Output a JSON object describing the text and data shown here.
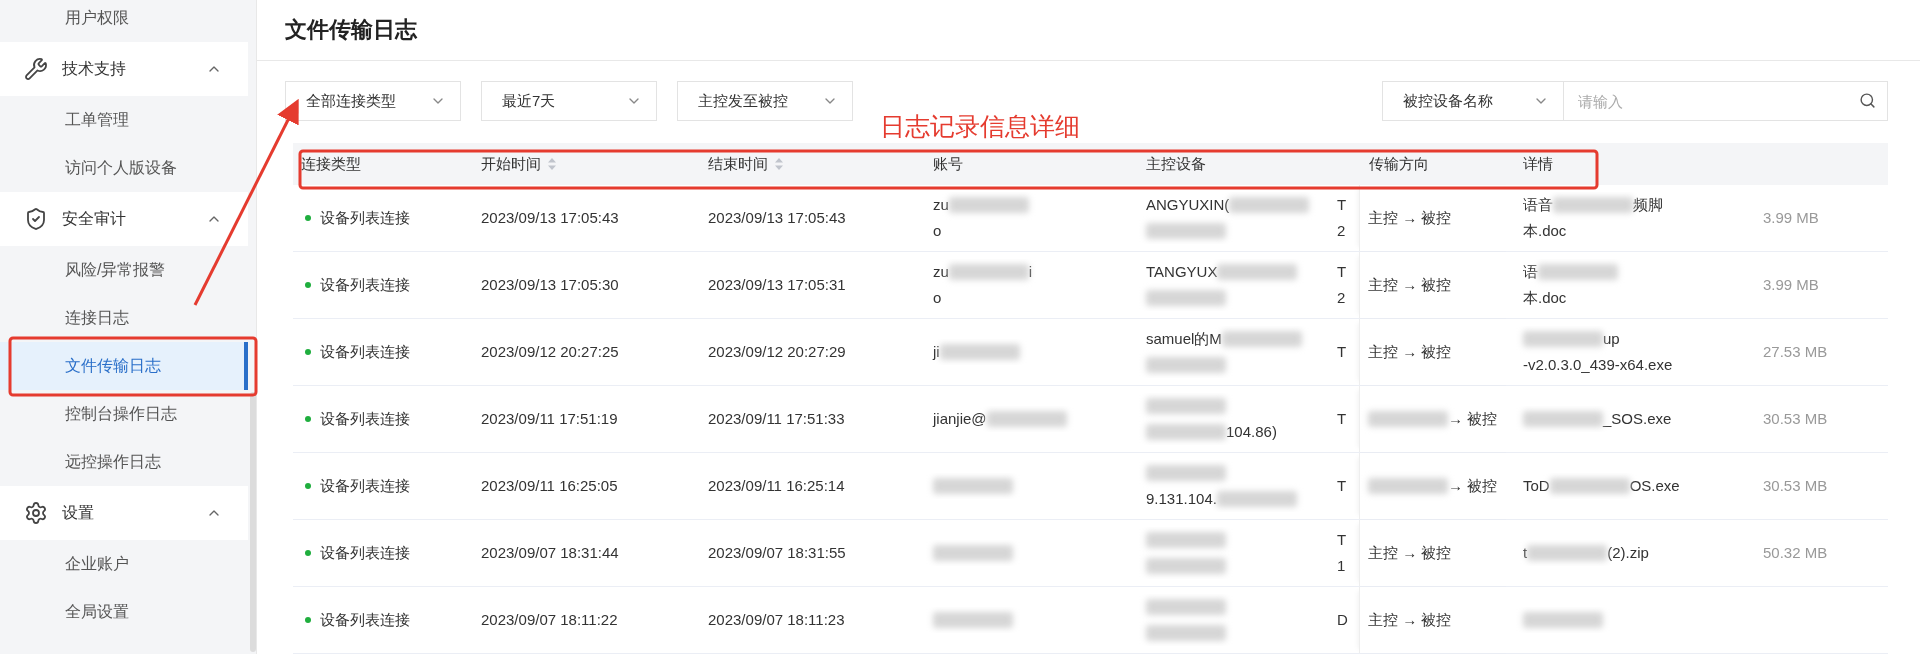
{
  "sidebar": [
    {
      "kind": "item",
      "label": "用户权限",
      "selected": false
    },
    {
      "kind": "group",
      "label": "技术支持",
      "expanded": true,
      "children": [
        {
          "label": "工单管理",
          "selected": false
        },
        {
          "label": "访问个人版设备",
          "selected": false
        }
      ]
    },
    {
      "kind": "group",
      "label": "安全审计",
      "expanded": true,
      "children": [
        {
          "label": "风险/异常报警",
          "selected": false
        },
        {
          "label": "连接日志",
          "selected": false
        },
        {
          "label": "文件传输日志",
          "selected": true
        },
        {
          "label": "控制台操作日志",
          "selected": false
        },
        {
          "label": "远控操作日志",
          "selected": false
        }
      ]
    },
    {
      "kind": "group",
      "label": "设置",
      "expanded": true,
      "children": [
        {
          "label": "企业账户",
          "selected": false
        },
        {
          "label": "全局设置",
          "selected": false
        }
      ]
    }
  ],
  "page_title": "文件传输日志",
  "filters": [
    {
      "value": "全部连接类型"
    },
    {
      "value": "最近7天"
    },
    {
      "value": "主控发至被控"
    }
  ],
  "search": {
    "field": "被控设备名称",
    "placeholder": "请输入"
  },
  "annotation": {
    "label": "日志记录信息详细"
  },
  "table": {
    "columns": [
      {
        "label": "连接类型",
        "sortable": false
      },
      {
        "label": "开始时间",
        "sortable": true
      },
      {
        "label": "结束时间",
        "sortable": true
      },
      {
        "label": "账号",
        "sortable": false
      },
      {
        "label": "主控设备",
        "sortable": false
      },
      {
        "sortable": false
      },
      {
        "label": "传输方向",
        "sortable": false
      },
      {
        "label": "详情",
        "sortable": false
      },
      {
        "sortable": false
      }
    ],
    "rows": [
      {
        "type": "设备列表连接",
        "start": "2023/09/13 17:05:43",
        "end": "2023/09/13 17:05:43",
        "account": [
          [
            {
              "kind": "text",
              "text": "zu"
            },
            {
              "kind": "blur"
            }
          ],
          [
            {
              "kind": "text",
              "text": "o"
            }
          ]
        ],
        "master": [
          [
            {
              "kind": "text",
              "text": "ANGYUXIN("
            },
            {
              "kind": "blur"
            }
          ],
          [
            {
              "kind": "blur"
            }
          ]
        ],
        "column_6": [
          "T",
          "2"
        ],
        "direction": [
          {
            "kind": "text",
            "text": "主控 → 被控"
          }
        ],
        "detail": [
          [
            {
              "kind": "text",
              "text": "语音"
            },
            {
              "kind": "blur"
            },
            {
              "kind": "text",
              "text": "频脚"
            }
          ],
          [
            {
              "kind": "text",
              "text": "本.doc"
            }
          ]
        ],
        "size": "3.99 MB"
      },
      {
        "type": "设备列表连接",
        "start": "2023/09/13 17:05:30",
        "end": "2023/09/13 17:05:31",
        "account": [
          [
            {
              "kind": "text",
              "text": "zu"
            },
            {
              "kind": "blur"
            },
            {
              "kind": "text",
              "text": "i"
            }
          ],
          [
            {
              "kind": "text",
              "text": "o"
            }
          ]
        ],
        "master": [
          [
            {
              "kind": "text",
              "text": "TANGYUX"
            },
            {
              "kind": "blur"
            }
          ],
          [
            {
              "kind": "blur"
            }
          ]
        ],
        "column_6": [
          "T",
          "2"
        ],
        "direction": [
          {
            "kind": "text",
            "text": "主控 → 被控"
          }
        ],
        "detail": [
          [
            {
              "kind": "text",
              "text": "语"
            },
            {
              "kind": "blur"
            }
          ],
          [
            {
              "kind": "text",
              "text": "本.doc"
            }
          ]
        ],
        "size": "3.99 MB"
      },
      {
        "type": "设备列表连接",
        "start": "2023/09/12 20:27:25",
        "end": "2023/09/12 20:27:29",
        "account": [
          [
            {
              "kind": "text",
              "text": "ji"
            },
            {
              "kind": "blur"
            }
          ]
        ],
        "master": [
          [
            {
              "kind": "text",
              "text": "samuel的M"
            },
            {
              "kind": "blur"
            }
          ],
          [
            {
              "kind": "blur"
            }
          ]
        ],
        "column_6": [
          "T"
        ],
        "direction": [
          {
            "kind": "text",
            "text": "主控 → 被控"
          }
        ],
        "detail": [
          [
            {
              "kind": "blur"
            },
            {
              "kind": "text",
              "text": "up"
            }
          ],
          [
            {
              "kind": "text",
              "text": "-v2.0.3.0_439-x64.exe"
            }
          ]
        ],
        "size": "27.53 MB"
      },
      {
        "type": "设备列表连接",
        "start": "2023/09/11 17:51:19",
        "end": "2023/09/11 17:51:33",
        "account": [
          [
            {
              "kind": "text",
              "text": "jianjie@"
            },
            {
              "kind": "blur"
            }
          ]
        ],
        "master": [
          [
            {
              "kind": "blur"
            }
          ],
          [
            {
              "kind": "blur"
            },
            {
              "kind": "text",
              "text": "104.86)"
            }
          ]
        ],
        "column_6": [
          "T"
        ],
        "direction": [
          {
            "kind": "blur"
          },
          {
            "kind": "text",
            "text": "→ 被控"
          }
        ],
        "detail": [
          [
            {
              "kind": "blur"
            },
            {
              "kind": "text",
              "text": "_SOS.exe"
            }
          ]
        ],
        "size": "30.53 MB"
      },
      {
        "type": "设备列表连接",
        "start": "2023/09/11 16:25:05",
        "end": "2023/09/11 16:25:14",
        "account": [
          [
            {
              "kind": "blur"
            }
          ]
        ],
        "master": [
          [
            {
              "kind": "blur"
            }
          ],
          [
            {
              "kind": "text",
              "text": "9.131.104."
            },
            {
              "kind": "blur"
            }
          ]
        ],
        "column_6": [
          "T"
        ],
        "direction": [
          {
            "kind": "blur"
          },
          {
            "kind": "text",
            "text": "→ 被控"
          }
        ],
        "detail": [
          [
            {
              "kind": "text",
              "text": "ToD"
            },
            {
              "kind": "blur"
            },
            {
              "kind": "text",
              "text": "OS.exe"
            }
          ]
        ],
        "size": "30.53 MB"
      },
      {
        "type": "设备列表连接",
        "start": "2023/09/07 18:31:44",
        "end": "2023/09/07 18:31:55",
        "account": [
          [
            {
              "kind": "blur"
            }
          ]
        ],
        "master": [
          [
            {
              "kind": "blur"
            }
          ],
          [
            {
              "kind": "blur"
            }
          ]
        ],
        "column_6": [
          "T",
          "1"
        ],
        "direction": [
          {
            "kind": "text",
            "text": "主控 → 被控"
          }
        ],
        "detail": [
          [
            {
              "kind": "text",
              "text": "t"
            },
            {
              "kind": "blur"
            },
            {
              "kind": "text",
              "text": "(2).zip"
            }
          ]
        ],
        "size": "50.32 MB"
      },
      {
        "type": "设备列表连接",
        "start": "2023/09/07 18:11:22",
        "end": "2023/09/07 18:11:23",
        "account": [
          [
            {
              "kind": "blur"
            }
          ]
        ],
        "master": [
          [
            {
              "kind": "blur"
            }
          ],
          [
            {
              "kind": "blur"
            }
          ]
        ],
        "column_6": [
          "D"
        ],
        "direction": [
          {
            "kind": "text",
            "text": "主控 → 被控"
          }
        ],
        "detail": [
          [
            {
              "kind": "blur"
            }
          ]
        ]
      }
    ]
  }
}
